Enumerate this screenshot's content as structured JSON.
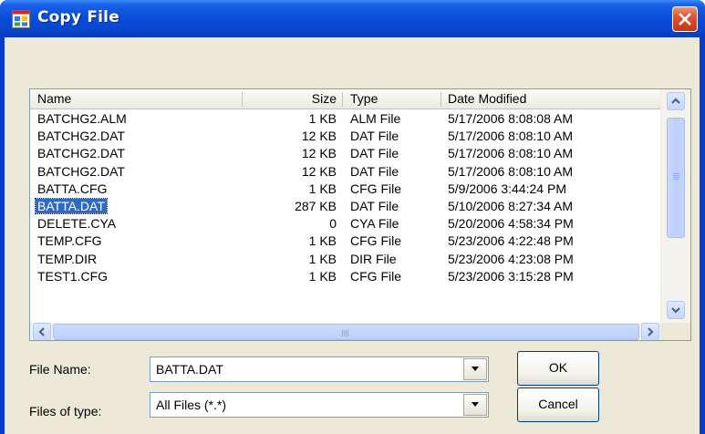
{
  "window": {
    "title": "Copy File"
  },
  "list": {
    "columns": [
      "Name",
      "Size",
      "Type",
      "Date Modified"
    ],
    "rows": [
      {
        "name": "BATCHG2.ALM",
        "size": "1 KB",
        "type": "ALM File",
        "date": "5/17/2006 8:08:08 AM"
      },
      {
        "name": "BATCHG2.DAT",
        "size": "12 KB",
        "type": "DAT File",
        "date": "5/17/2006 8:08:10 AM"
      },
      {
        "name": "BATCHG2.DAT",
        "size": "12 KB",
        "type": "DAT File",
        "date": "5/17/2006 8:08:10 AM"
      },
      {
        "name": "BATCHG2.DAT",
        "size": "12 KB",
        "type": "DAT File",
        "date": "5/17/2006 8:08:10 AM"
      },
      {
        "name": "BATTA.CFG",
        "size": "1 KB",
        "type": "CFG File",
        "date": "5/9/2006 3:44:24 PM"
      },
      {
        "name": "BATTA.DAT",
        "size": "287 KB",
        "type": "DAT File",
        "date": "5/10/2006 8:27:34 AM",
        "selected": true
      },
      {
        "name": "DELETE.CYA",
        "size": "0",
        "type": "CYA File",
        "date": "5/20/2006 4:58:34 PM"
      },
      {
        "name": "TEMP.CFG",
        "size": "1 KB",
        "type": "CFG File",
        "date": "5/23/2006 4:22:48 PM"
      },
      {
        "name": "TEMP.DIR",
        "size": "1 KB",
        "type": "DIR File",
        "date": "5/23/2006 4:23:08 PM"
      },
      {
        "name": "TEST1.CFG",
        "size": "1 KB",
        "type": "CFG File",
        "date": "5/23/2006 3:15:28 PM"
      }
    ]
  },
  "form": {
    "file_name_label": "File Name:",
    "file_name_value": "BATTA.DAT",
    "files_of_type_label": "Files of type:",
    "files_of_type_value": "All Files (*.*)"
  },
  "buttons": {
    "ok": "OK",
    "cancel": "Cancel"
  },
  "icons": {
    "app": "copy-file-app-icon",
    "close": "close-icon",
    "scroll_up": "arrow-up-icon",
    "scroll_down": "arrow-down-icon",
    "scroll_left": "arrow-left-icon",
    "scroll_right": "arrow-right-icon",
    "dropdown": "dropdown-arrow-icon"
  },
  "colors": {
    "titlebar": "#0a4ed8",
    "selection": "#316ac5",
    "dialog_face": "#ece9d8",
    "close_button": "#d04420"
  }
}
